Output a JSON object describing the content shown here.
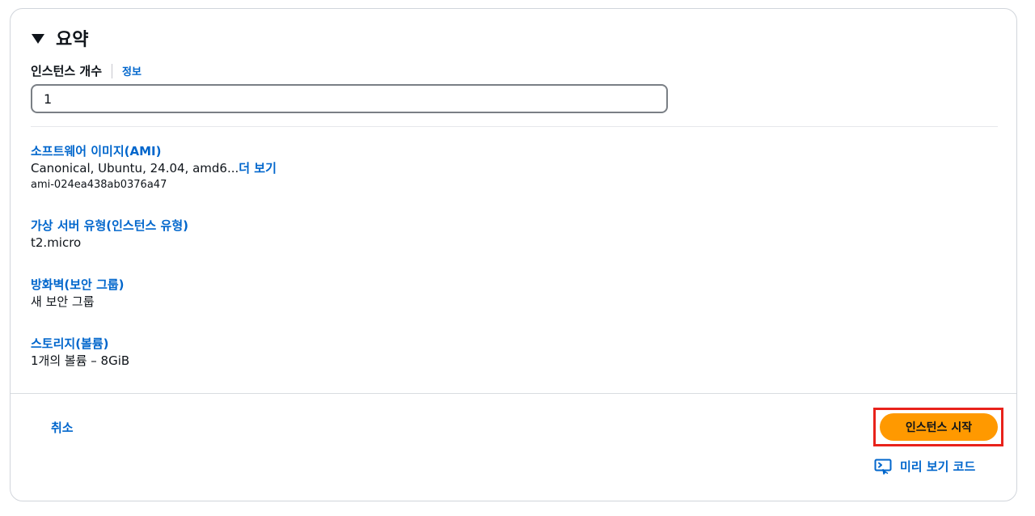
{
  "section": {
    "title": "요약"
  },
  "instance_count": {
    "label": "인스턴스 개수",
    "info_link": "정보",
    "value": "1"
  },
  "summary": {
    "ami": {
      "label": "소프트웨어 이미지(AMI)",
      "value": "Canonical, Ubuntu, 24.04, amd6...",
      "more_link": "더 보기",
      "ami_id": "ami-024ea438ab0376a47"
    },
    "instance_type": {
      "label": "가상 서버 유형(인스턴스 유형)",
      "value": "t2.micro"
    },
    "firewall": {
      "label": "방화벽(보안 그룹)",
      "value": "새 보안 그룹"
    },
    "storage": {
      "label": "스토리지(볼륨)",
      "value": "1개의 볼륨 – 8GiB"
    }
  },
  "footer": {
    "cancel_label": "취소",
    "launch_label": "인스턴스 시작",
    "preview_code_label": "미리 보기 코드"
  },
  "colors": {
    "link": "#0066cc",
    "primary_button": "#ff9900",
    "highlight": "#e8221b"
  },
  "icons": {
    "section_toggle": "caret-down-icon",
    "preview_code": "code-preview-icon"
  }
}
